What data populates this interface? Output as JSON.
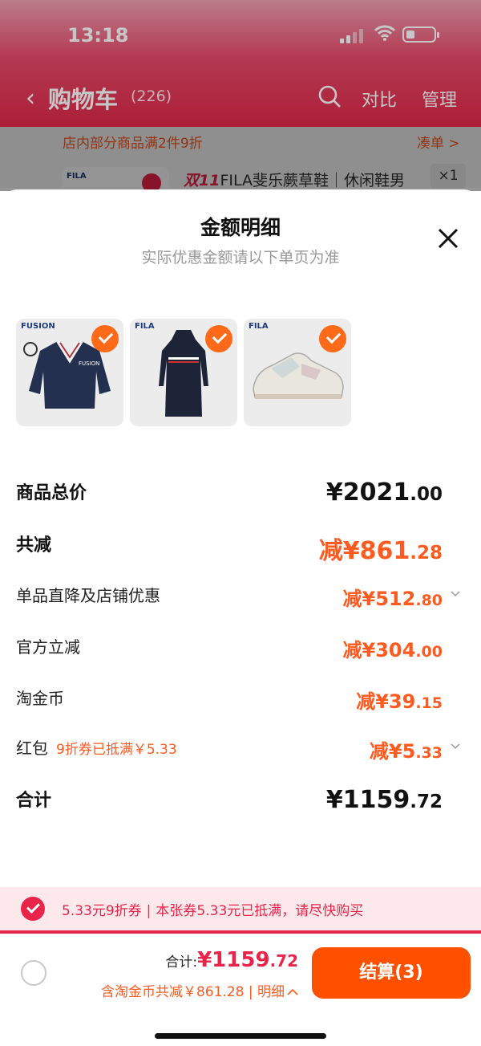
{
  "status": {
    "time": "13:18"
  },
  "nav": {
    "title": "购物车",
    "count": "(226)",
    "compare": "对比",
    "manage": "管理"
  },
  "promo": {
    "text": "店内部分商品满2件9折",
    "link": "凑单 >",
    "thumb_brand": "FILA",
    "product_tag": "双11",
    "product_title": "FILA斐乐蕨草鞋｜休闲鞋男",
    "qty": "×1"
  },
  "sheet": {
    "title": "金额明细",
    "subtitle": "实际优惠金额请以下单页为准",
    "items": [
      {
        "brand": "FUSION",
        "kind": "sweater",
        "checked": true
      },
      {
        "brand": "FILA",
        "kind": "dress",
        "checked": true
      },
      {
        "brand": "FILA",
        "kind": "sneaker",
        "checked": true
      }
    ],
    "rows": {
      "total": {
        "label": "商品总价",
        "main": "¥2021",
        "dec": ".00"
      },
      "reduce": {
        "label": "共减",
        "main": "减¥861",
        "dec": ".28"
      },
      "shop": {
        "label": "单品直降及店铺优惠",
        "main": "减¥512",
        "dec": ".80"
      },
      "official": {
        "label": "官方立减",
        "main": "减¥304",
        "dec": ".00"
      },
      "coin": {
        "label": "淘金币",
        "main": "减¥39",
        "dec": ".15"
      },
      "redpack": {
        "label": "红包",
        "extra": "9折券已抵满￥5.33",
        "main": "减¥5",
        "dec": ".33"
      },
      "sum": {
        "label": "合计",
        "main": "¥1159",
        "dec": ".72"
      }
    }
  },
  "banner": {
    "coupon": "5.33元9折券",
    "sep": "|",
    "note": "本张券5.33元已抵满，请尽快购买"
  },
  "bottom": {
    "total_label": "合计:",
    "total_main": "¥1159",
    "total_dec": ".72",
    "detail": "含淘金币共减￥861.28 | 明细",
    "checkout": "结算(3)"
  },
  "colors": {
    "accent": "#ff5000",
    "red": "#e8244a"
  }
}
